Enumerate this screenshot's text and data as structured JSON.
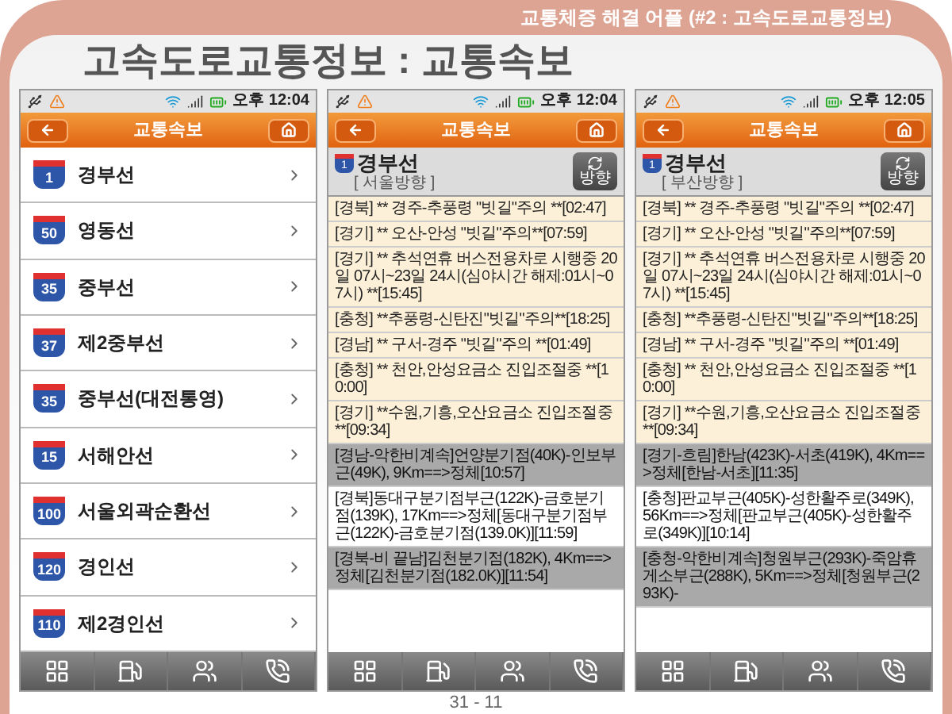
{
  "slide": {
    "header": "교통체증 해결 어플 (#2 : 고속도로교통정보)",
    "title": "고속도로교통정보 : 교통속보",
    "page_number": "31 - 11"
  },
  "phones": [
    {
      "kind": "routes",
      "time": "오후 12:04",
      "title": "교통속보",
      "routes": [
        {
          "number": "1",
          "name": "경부선"
        },
        {
          "number": "50",
          "name": "영동선"
        },
        {
          "number": "35",
          "name": "중부선"
        },
        {
          "number": "37",
          "name": "제2중부선"
        },
        {
          "number": "35",
          "name": "중부선(대전통영)"
        },
        {
          "number": "15",
          "name": "서해안선"
        },
        {
          "number": "100",
          "name": "서울외곽순환선"
        },
        {
          "number": "120",
          "name": "경인선"
        },
        {
          "number": "110",
          "name": "제2경인선"
        }
      ]
    },
    {
      "kind": "bulletins",
      "time": "오후 12:04",
      "title": "교통속보",
      "route": {
        "number": "1",
        "name": "경부선",
        "direction": "[ 서울방향 ]"
      },
      "direction_button": "방향",
      "bulletins": [
        {
          "kind": "alert",
          "text": "[경북] ** 경주-추풍령 \"빗길\"주의 **[02:47]"
        },
        {
          "kind": "alert",
          "text": "[경기] ** 오산-안성 \"빗길\"주의**[07:59]"
        },
        {
          "kind": "alert",
          "text": "[경기] ** 추석연휴 버스전용차로 시행중 20일 07시~23일 24시(심야시간 해제:01시~07시) **[15:45]"
        },
        {
          "kind": "alert",
          "text": "[충청] **추풍령-신탄진\"빗길\"주의**[18:25]"
        },
        {
          "kind": "alert",
          "text": "[경남] ** 구서-경주 \"빗길\"주의 **[01:49]"
        },
        {
          "kind": "alert",
          "text": "[충청] ** 천안,안성요금소 진입조절중 **[10:00]"
        },
        {
          "kind": "alert",
          "text": "[경기] **수원,기흥,오산요금소 진입조절중**[09:34]"
        },
        {
          "kind": "jam",
          "text": "[경남-악한비계속]언양분기점(40K)-인보부근(49K), 9Km==>정체[10:57]"
        },
        {
          "kind": "jam",
          "text": "[경북]동대구분기점부근(122K)-금호분기점(139K), 17Km==>정체[동대구분기점부근(122K)-금호분기점(139.0K)][11:59]"
        },
        {
          "kind": "jam",
          "text": "[경북-비 끝남]김천분기점(182K), 4Km==>정체[김천분기점(182.0K)][11:54]"
        }
      ]
    },
    {
      "kind": "bulletins",
      "time": "오후 12:05",
      "title": "교통속보",
      "route": {
        "number": "1",
        "name": "경부선",
        "direction": "[ 부산방향 ]"
      },
      "direction_button": "방향",
      "bulletins": [
        {
          "kind": "alert",
          "text": "[경북] ** 경주-추풍령 \"빗길\"주의 **[02:47]"
        },
        {
          "kind": "alert",
          "text": "[경기] ** 오산-안성 \"빗길\"주의**[07:59]"
        },
        {
          "kind": "alert",
          "text": "[경기] ** 추석연휴 버스전용차로 시행중 20일 07시~23일 24시(심야시간 해제:01시~07시) **[15:45]"
        },
        {
          "kind": "alert",
          "text": "[충청] **추풍령-신탄진\"빗길\"주의**[18:25]"
        },
        {
          "kind": "alert",
          "text": "[경남] ** 구서-경주 \"빗길\"주의 **[01:49]"
        },
        {
          "kind": "alert",
          "text": "[충청] ** 천안,안성요금소 진입조절중 **[10:00]"
        },
        {
          "kind": "alert",
          "text": "[경기] **수원,기흥,오산요금소 진입조절중**[09:34]"
        },
        {
          "kind": "jam",
          "text": "[경기-흐림]한남(423K)-서초(419K), 4Km==>정체[한남-서초][11:35]"
        },
        {
          "kind": "jam",
          "text": "[충청]판교부근(405K)-성한활주로(349K), 56Km==>정체[판교부근(405K)-성한활주로(349K)][10:14]"
        },
        {
          "kind": "jam",
          "text": "[충청-악한비계속]청원부근(293K)-죽암휴게소부근(288K), 5Km==>정체[청원부근(293K)-"
        }
      ]
    }
  ]
}
